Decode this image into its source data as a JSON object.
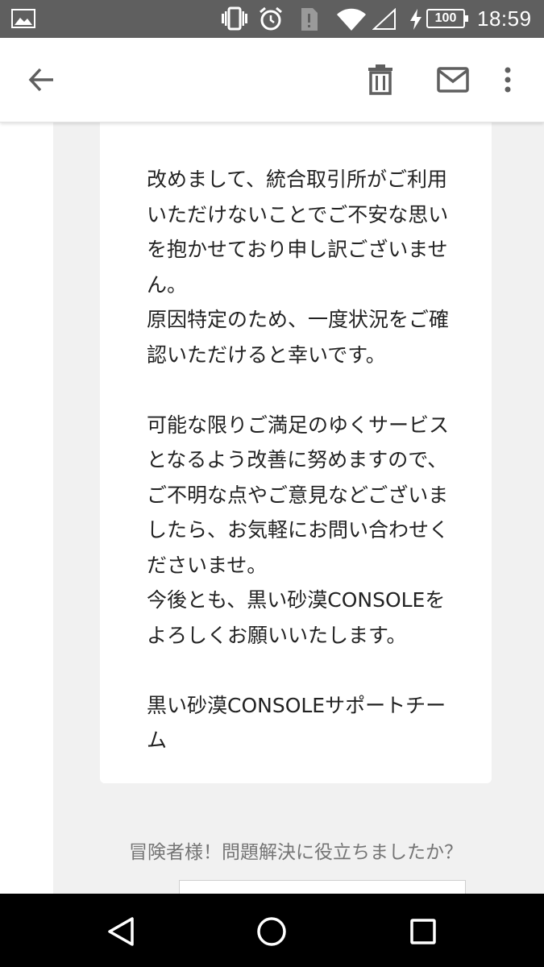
{
  "status_bar": {
    "time": "18:59",
    "battery": "100",
    "icons": [
      "image-icon",
      "vibrate-icon",
      "alarm-icon",
      "alert-icon",
      "wifi-icon",
      "signal-icon",
      "charging-icon"
    ]
  },
  "toolbar": {
    "icons": [
      "back-arrow-icon",
      "delete-icon",
      "mark-unread-icon",
      "more-vert-icon"
    ]
  },
  "message": {
    "paragraphs": [
      "改めまして、統合取引所がご利用\nいただけないことでご不安な思い\nを抱かせており申し訳ございませ\nん。\n原因特定のため、一度状況をご確\n認いただけると幸いです。",
      "可能な限りご満足のゆくサービス\nとなるよう改善に努めますので、\nご不明な点やご意見などございま\nしたら、お気軽にお問い合わせく\nださいませ。\n今後とも、黒い砂漠CONSOLEを\nよろしくお願いいたします。",
      "黒い砂漠CONSOLEサポートチー\nム"
    ]
  },
  "feedback": {
    "question": "冒険者様！問題解決に役立ちましたか？"
  },
  "nav_bar": {
    "icons": [
      "back-triangle-icon",
      "home-circle-icon",
      "recents-square-icon"
    ]
  },
  "colors": {
    "status_bar": "#5f5f5f",
    "text": "#222222",
    "panel": "#f1f1f1",
    "muted_text": "#757575"
  }
}
